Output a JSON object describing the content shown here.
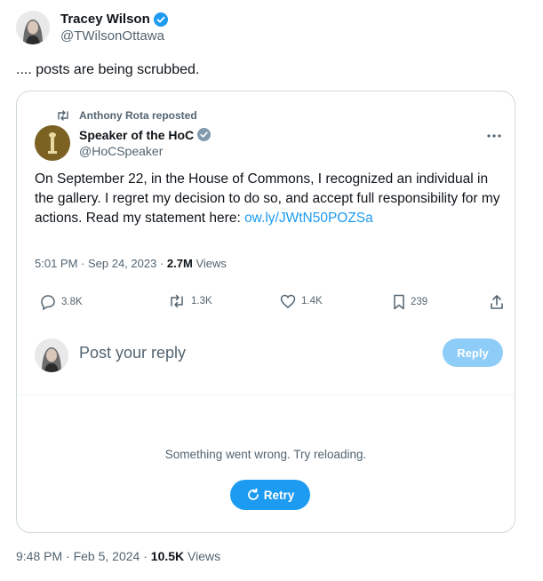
{
  "author": {
    "name": "Tracey Wilson",
    "handle": "@TWilsonOttawa"
  },
  "post_text": ".... posts are being scrubbed.",
  "quoted": {
    "repost_label": "Anthony Rota reposted",
    "name": "Speaker of the HoC",
    "handle": "@HoCSpeaker",
    "body": "On September 22, in the House of Commons, I recognized an individual in the gallery. I regret my decision to do so, and accept full responsibility for my actions. Read my statement here: ",
    "link": "ow.ly/JWtN50POZSa",
    "time": "5:01 PM",
    "date": "Sep 24, 2023",
    "views": "2.7M",
    "views_label": "Views",
    "stats": {
      "replies": "3.8K",
      "reposts": "1.3K",
      "likes": "1.4K",
      "bookmarks": "239"
    },
    "reply_placeholder": "Post your reply",
    "reply_button": "Reply",
    "error": "Something went wrong. Try reloading.",
    "retry_button": "Retry"
  },
  "footer": {
    "time": "9:48 PM",
    "date": "Feb 5, 2024",
    "views": "10.5K",
    "views_label": "Views"
  },
  "colors": {
    "accent": "#1d9bf0",
    "reply_disabled": "#8ecdf7",
    "muted": "#536471",
    "border": "#cfd9de"
  }
}
